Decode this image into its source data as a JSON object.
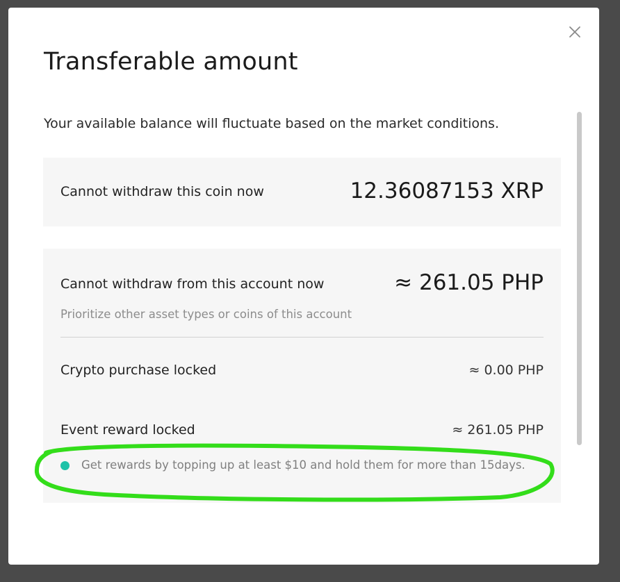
{
  "modal": {
    "title": "Transferable amount",
    "subtitle": "Your available balance will fluctuate based on the market conditions.",
    "close_icon": "close-icon"
  },
  "coin_card": {
    "label": "Cannot withdraw this coin now",
    "value": "12.36087153 XRP"
  },
  "account_card": {
    "label": "Cannot withdraw from this account now",
    "value": "≈ 261.05 PHP",
    "hint": "Prioritize other asset types or coins of this account",
    "rows": [
      {
        "label": "Crypto purchase locked",
        "value": "≈ 0.00 PHP"
      },
      {
        "label": "Event reward locked",
        "value": "≈ 261.05 PHP"
      }
    ],
    "note": "Get rewards by topping up at least $10 and hold them for more than 15days."
  },
  "colors": {
    "accent_dot": "#1ec2a8",
    "highlight_stroke": "#33dd1a"
  }
}
